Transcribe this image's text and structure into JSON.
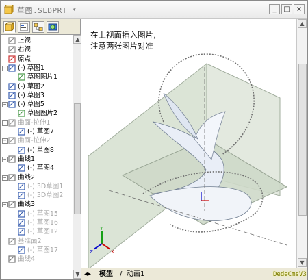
{
  "window": {
    "title": "草图.SLDPRT *",
    "buttons": {
      "minimize": "_",
      "maximize": "□",
      "close": "×"
    }
  },
  "left_panel": {
    "tabs": [
      {
        "icon": "feature-manager-icon",
        "active": true
      },
      {
        "icon": "property-manager-icon",
        "active": false
      },
      {
        "icon": "configuration-manager-icon",
        "active": false
      },
      {
        "icon": "dim-xpert-icon",
        "active": false
      }
    ],
    "tree": [
      {
        "label": "上视",
        "icon": "plane-icon",
        "dim": false
      },
      {
        "label": "右视",
        "icon": "plane-icon",
        "dim": false
      },
      {
        "label": "原点",
        "icon": "origin-icon",
        "dim": false
      },
      {
        "label": "(-) 草图1",
        "icon": "sketch-icon",
        "dim": false
      },
      {
        "label": "草图图片1",
        "icon": "sketch-picture-icon",
        "dim": false
      },
      {
        "label": "(-) 草图2",
        "icon": "sketch-icon",
        "dim": false
      },
      {
        "label": "(-) 草图3",
        "icon": "sketch-icon",
        "dim": false
      },
      {
        "label": "(-) 草图5",
        "icon": "sketch-icon",
        "dim": false
      },
      {
        "label": "草图图片2",
        "icon": "sketch-picture-icon",
        "dim": false
      },
      {
        "label": "曲面-拉伸1",
        "icon": "surface-extrude-icon",
        "dim": true
      },
      {
        "label": "(-) 草图7",
        "icon": "sketch-icon",
        "dim": false
      },
      {
        "label": "曲面-拉伸2",
        "icon": "surface-extrude-icon",
        "dim": true
      },
      {
        "label": "(-) 草图8",
        "icon": "sketch-icon",
        "dim": false
      },
      {
        "label": "曲线1",
        "icon": "curve-icon",
        "dim": false
      },
      {
        "label": "(-) 草图4",
        "icon": "sketch-icon",
        "dim": false
      },
      {
        "label": "曲线2",
        "icon": "curve-icon",
        "dim": false
      },
      {
        "label": "(-) 3D草图1",
        "icon": "sketch-3d-icon",
        "dim": true
      },
      {
        "label": "(-) 3D草图2",
        "icon": "sketch-3d-icon",
        "dim": true
      },
      {
        "label": "曲线3",
        "icon": "curve-icon",
        "dim": false
      },
      {
        "label": "(-) 草图15",
        "icon": "sketch-icon",
        "dim": true
      },
      {
        "label": "(-) 草图16",
        "icon": "sketch-icon",
        "dim": true
      },
      {
        "label": "(-) 草图12",
        "icon": "sketch-icon",
        "dim": true
      },
      {
        "label": "基准面2",
        "icon": "plane-icon",
        "dim": true
      },
      {
        "label": "(-) 草图17",
        "icon": "sketch-icon",
        "dim": true
      },
      {
        "label": "曲线4",
        "icon": "curve-icon",
        "dim": true
      }
    ]
  },
  "viewport": {
    "annotation_line1": "在上视面插入图片,",
    "annotation_line2": "注意两张图片对准",
    "axis_labels": {
      "x": "X",
      "y": "Y",
      "z": "Z"
    }
  },
  "bottom_tabs": [
    "模型",
    "动画1"
  ],
  "watermark": "DedeCmsV3",
  "colors": {
    "plane_fill": "#d9e3d5",
    "plane_edge": "#9aa896",
    "surface": "#e8eef6",
    "sketch_line": "#6a6a6a",
    "axis_x": "#cc0000",
    "axis_y": "#009900",
    "axis_z": "#0000cc"
  }
}
